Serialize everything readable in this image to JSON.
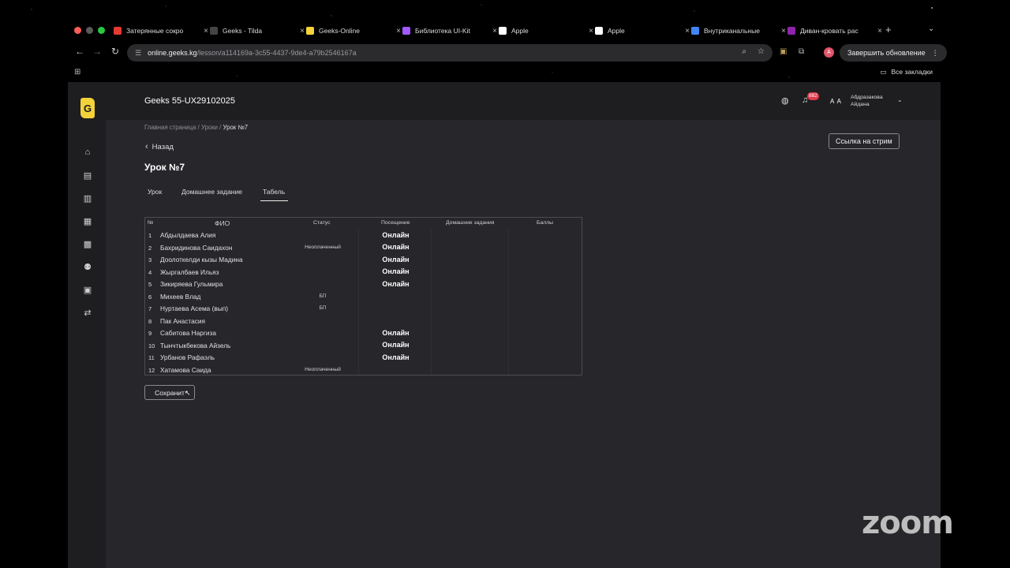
{
  "browser": {
    "tabs": [
      {
        "title": "Затерянные сокро",
        "icon": "youtube-icon",
        "color": "#e53935"
      },
      {
        "title": "Geeks - Tilda",
        "icon": "tilda-icon",
        "color": "#444444"
      },
      {
        "title": "Geeks-Online",
        "icon": "geeks-icon",
        "color": "#f3d23a"
      },
      {
        "title": "Библиотека UI-Kit",
        "icon": "figma-icon",
        "color": "#a259ff"
      },
      {
        "title": "Apple",
        "icon": "apple-icon",
        "color": "#ffffff"
      },
      {
        "title": "Apple",
        "icon": "apple-icon",
        "color": "#ffffff"
      },
      {
        "title": "Внутриканальные",
        "icon": "google-icon",
        "color": "#4285f4"
      },
      {
        "title": "Диван-кровать рас",
        "icon": "wb-icon",
        "color": "#8e24aa"
      }
    ],
    "url_host": "online.geeks.kg",
    "url_path": "/lesson/a114169a-3c55-4437-9de4-a79b2546167a",
    "profile_initial": "A",
    "update_label": "Завершить обновление",
    "all_bookmarks": "Все закладки"
  },
  "app": {
    "logo_letter": "G",
    "course_title": "Geeks 55-UX29102025",
    "notification_count": "882",
    "user_initials": "A A",
    "user_name_line1": "Абдразакова",
    "user_name_line2": "Айдана"
  },
  "breadcrumb": {
    "home": "Главная страница",
    "sep": " / ",
    "lessons": "Уроки",
    "current": "Урок №7"
  },
  "back_label": "Назад",
  "lesson_title": "Урок №7",
  "stream_link_label": "Ссылка на стрим",
  "tabs": {
    "lesson": "Урок",
    "homework": "Домашнее задание",
    "register": "Табель"
  },
  "table": {
    "headers": {
      "num": "№",
      "fio": "ФИО",
      "status": "Статус",
      "attendance": "Посещение",
      "homework": "Домашние задания",
      "points": "Баллы"
    },
    "rows": [
      {
        "num": "1",
        "name": "Абдылдаева Алия",
        "status": "",
        "attendance": "Онлайн"
      },
      {
        "num": "2",
        "name": "Бахридинова Саидахон",
        "status": "Неоплаченный",
        "attendance": "Онлайн"
      },
      {
        "num": "3",
        "name": "Доолоткелди кызы Мадина",
        "status": "",
        "attendance": "Онлайн"
      },
      {
        "num": "4",
        "name": "Жыргалбаев Ильяз",
        "status": "",
        "attendance": "Онлайн"
      },
      {
        "num": "5",
        "name": "Зикиряева Гульмира",
        "status": "",
        "attendance": "Онлайн"
      },
      {
        "num": "6",
        "name": "Михеев Влад",
        "status": "БП",
        "attendance": ""
      },
      {
        "num": "7",
        "name": "Нуртаева Асема (вып)",
        "status": "БП",
        "attendance": ""
      },
      {
        "num": "8",
        "name": "Пак Анастасия",
        "status": "",
        "attendance": ""
      },
      {
        "num": "9",
        "name": "Сабитова Наргиза",
        "status": "",
        "attendance": "Онлайн"
      },
      {
        "num": "10",
        "name": "Тынчтыкбекова Айзель",
        "status": "",
        "attendance": "Онлайн"
      },
      {
        "num": "11",
        "name": "Урбанов Рафаэль",
        "status": "",
        "attendance": "Онлайн"
      },
      {
        "num": "12",
        "name": "Хатамова Саида",
        "status": "Неоплаченный",
        "attendance": ""
      }
    ]
  },
  "save_label": "Сохранит",
  "watermark": "zoom"
}
